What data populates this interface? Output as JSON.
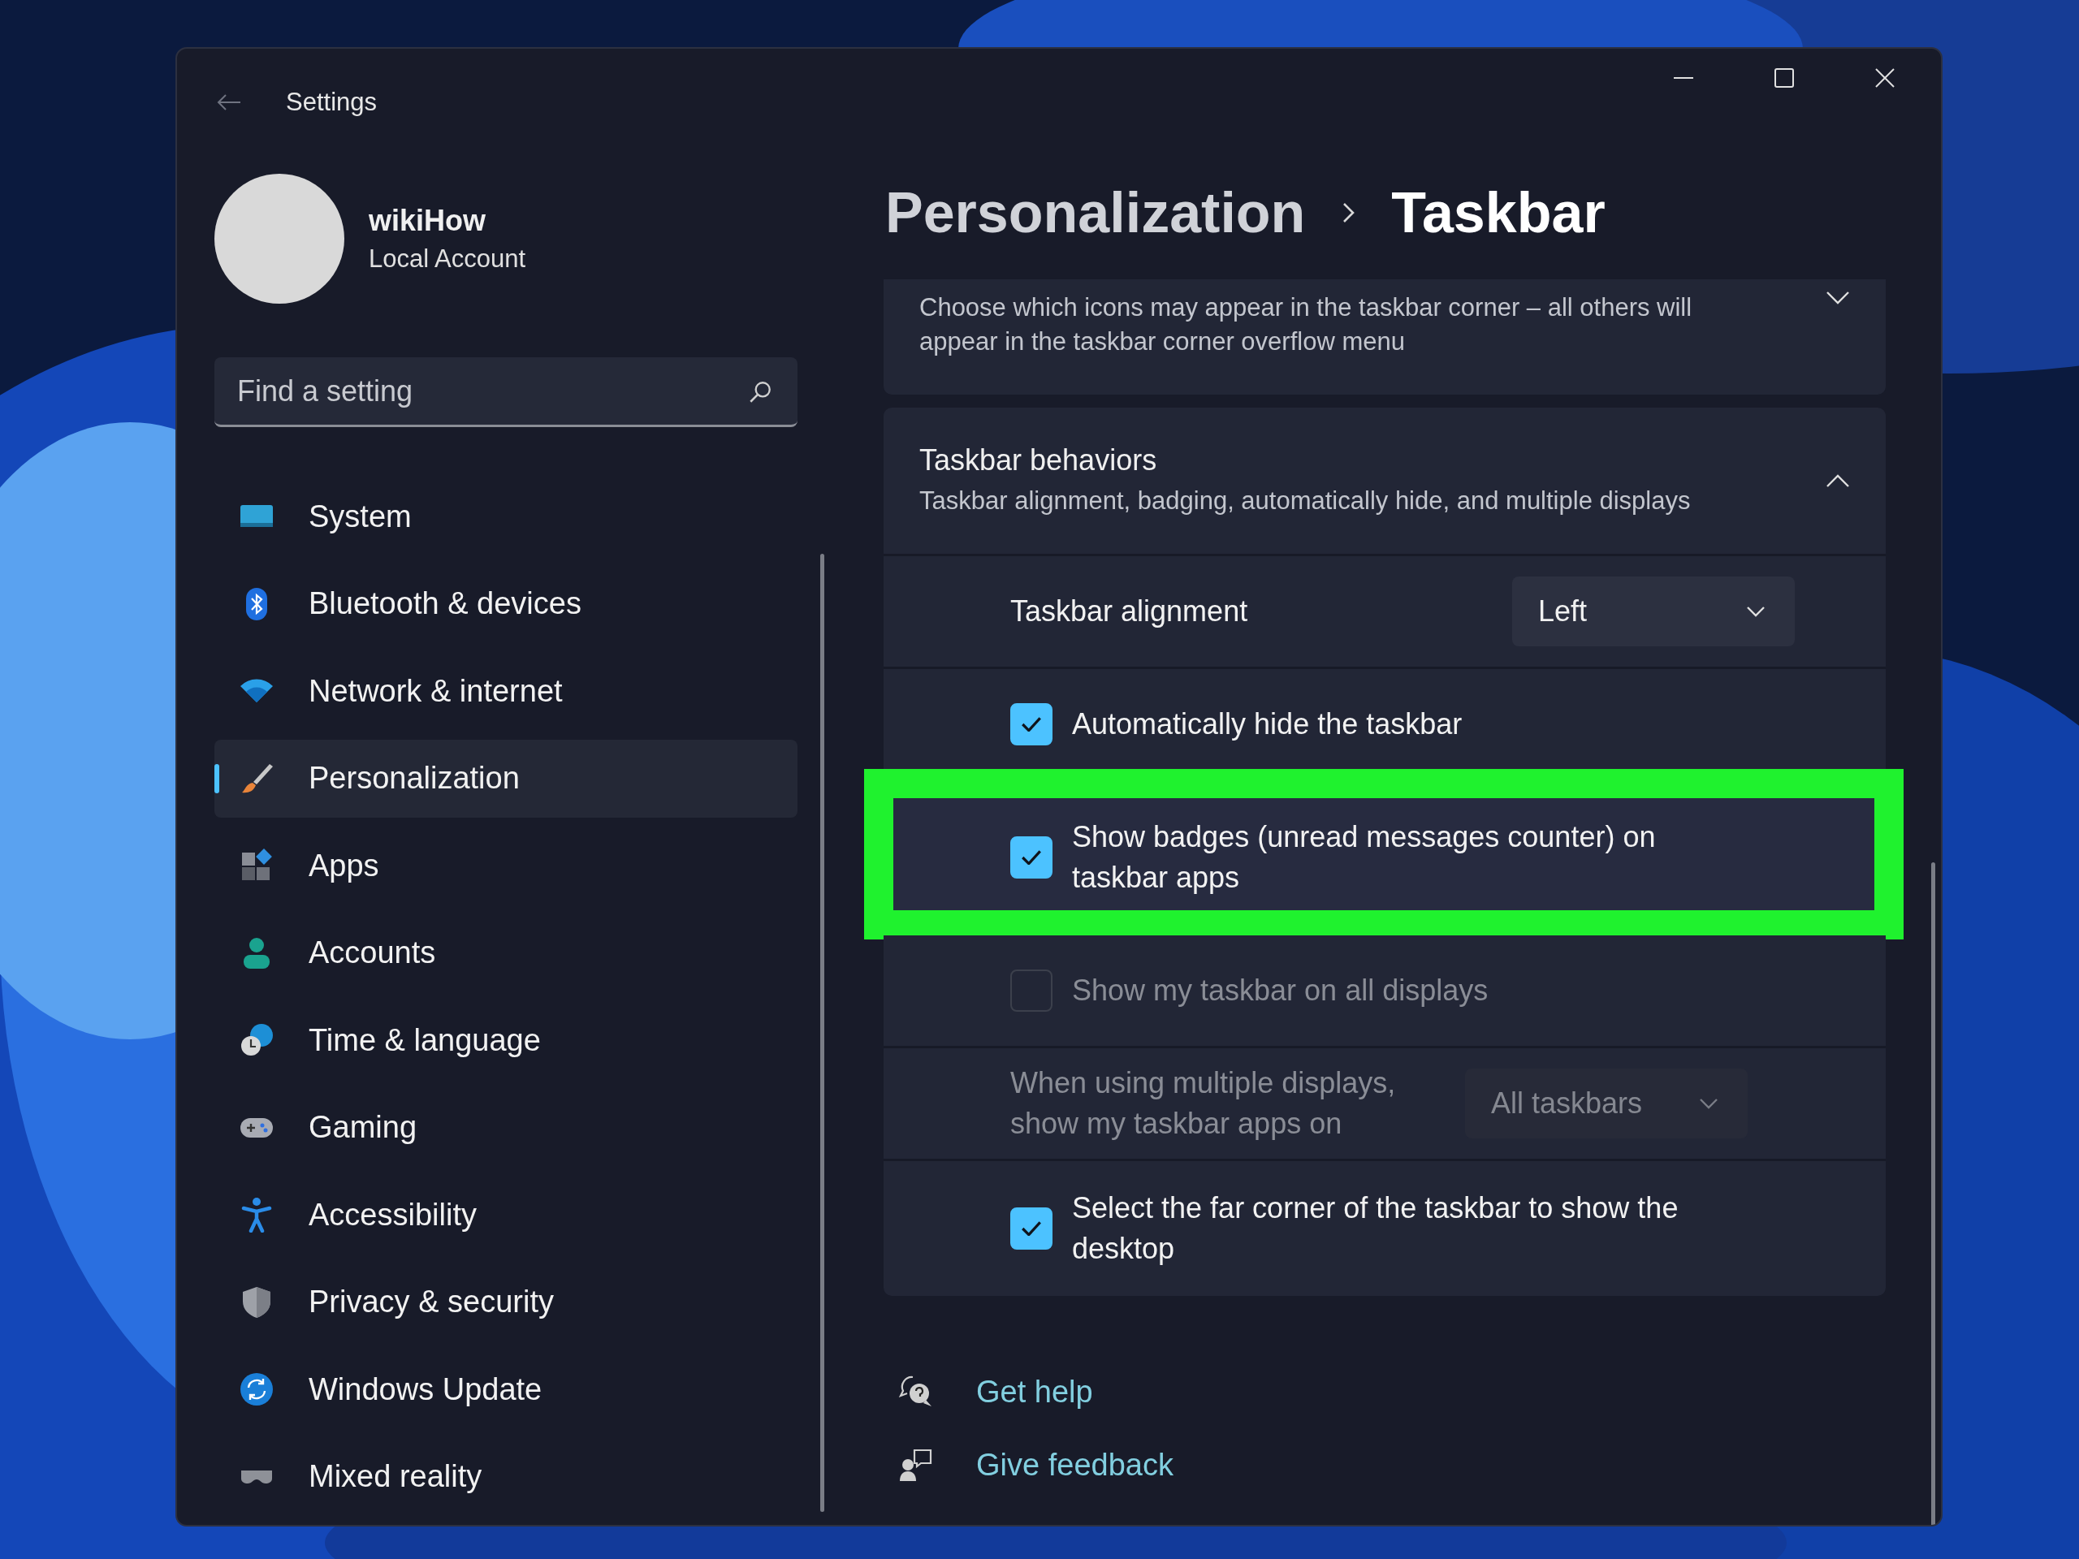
{
  "window": {
    "title": "Settings"
  },
  "account": {
    "name": "wikiHow",
    "type": "Local Account"
  },
  "search": {
    "placeholder": "Find a setting"
  },
  "nav": [
    {
      "label": "System",
      "selected": false
    },
    {
      "label": "Bluetooth & devices",
      "selected": false
    },
    {
      "label": "Network & internet",
      "selected": false
    },
    {
      "label": "Personalization",
      "selected": true
    },
    {
      "label": "Apps",
      "selected": false
    },
    {
      "label": "Accounts",
      "selected": false
    },
    {
      "label": "Time & language",
      "selected": false
    },
    {
      "label": "Gaming",
      "selected": false
    },
    {
      "label": "Accessibility",
      "selected": false
    },
    {
      "label": "Privacy & security",
      "selected": false
    },
    {
      "label": "Windows Update",
      "selected": false
    },
    {
      "label": "Mixed reality",
      "selected": false
    }
  ],
  "breadcrumb": {
    "parent": "Personalization",
    "current": "Taskbar"
  },
  "sections": [
    {
      "description": "Choose which icons may appear in the taskbar corner – all others will appear in the taskbar corner overflow menu",
      "expanded": false
    },
    {
      "title": "Taskbar behaviors",
      "description": "Taskbar alignment, badging, automatically hide, and multiple displays",
      "expanded": true,
      "settings": [
        {
          "kind": "dropdown",
          "label": "Taskbar alignment",
          "value": "Left",
          "disabled": false,
          "highlighted": false
        },
        {
          "kind": "checkbox",
          "label": "Automatically hide the taskbar",
          "checked": true,
          "disabled": false,
          "highlighted": false
        },
        {
          "kind": "checkbox",
          "label": "Show badges (unread messages counter) on taskbar apps",
          "checked": true,
          "disabled": false,
          "highlighted": true
        },
        {
          "kind": "checkbox",
          "label": "Show my taskbar on all displays",
          "checked": false,
          "disabled": true,
          "highlighted": false
        },
        {
          "kind": "dropdown",
          "label": "When using multiple displays, show my taskbar apps on",
          "value": "All taskbars",
          "disabled": true,
          "highlighted": false
        },
        {
          "kind": "checkbox",
          "label": "Select the far corner of the taskbar to show the desktop",
          "checked": true,
          "disabled": false,
          "highlighted": false
        }
      ]
    }
  ],
  "links": [
    {
      "label": "Get help"
    },
    {
      "label": "Give feedback"
    }
  ]
}
